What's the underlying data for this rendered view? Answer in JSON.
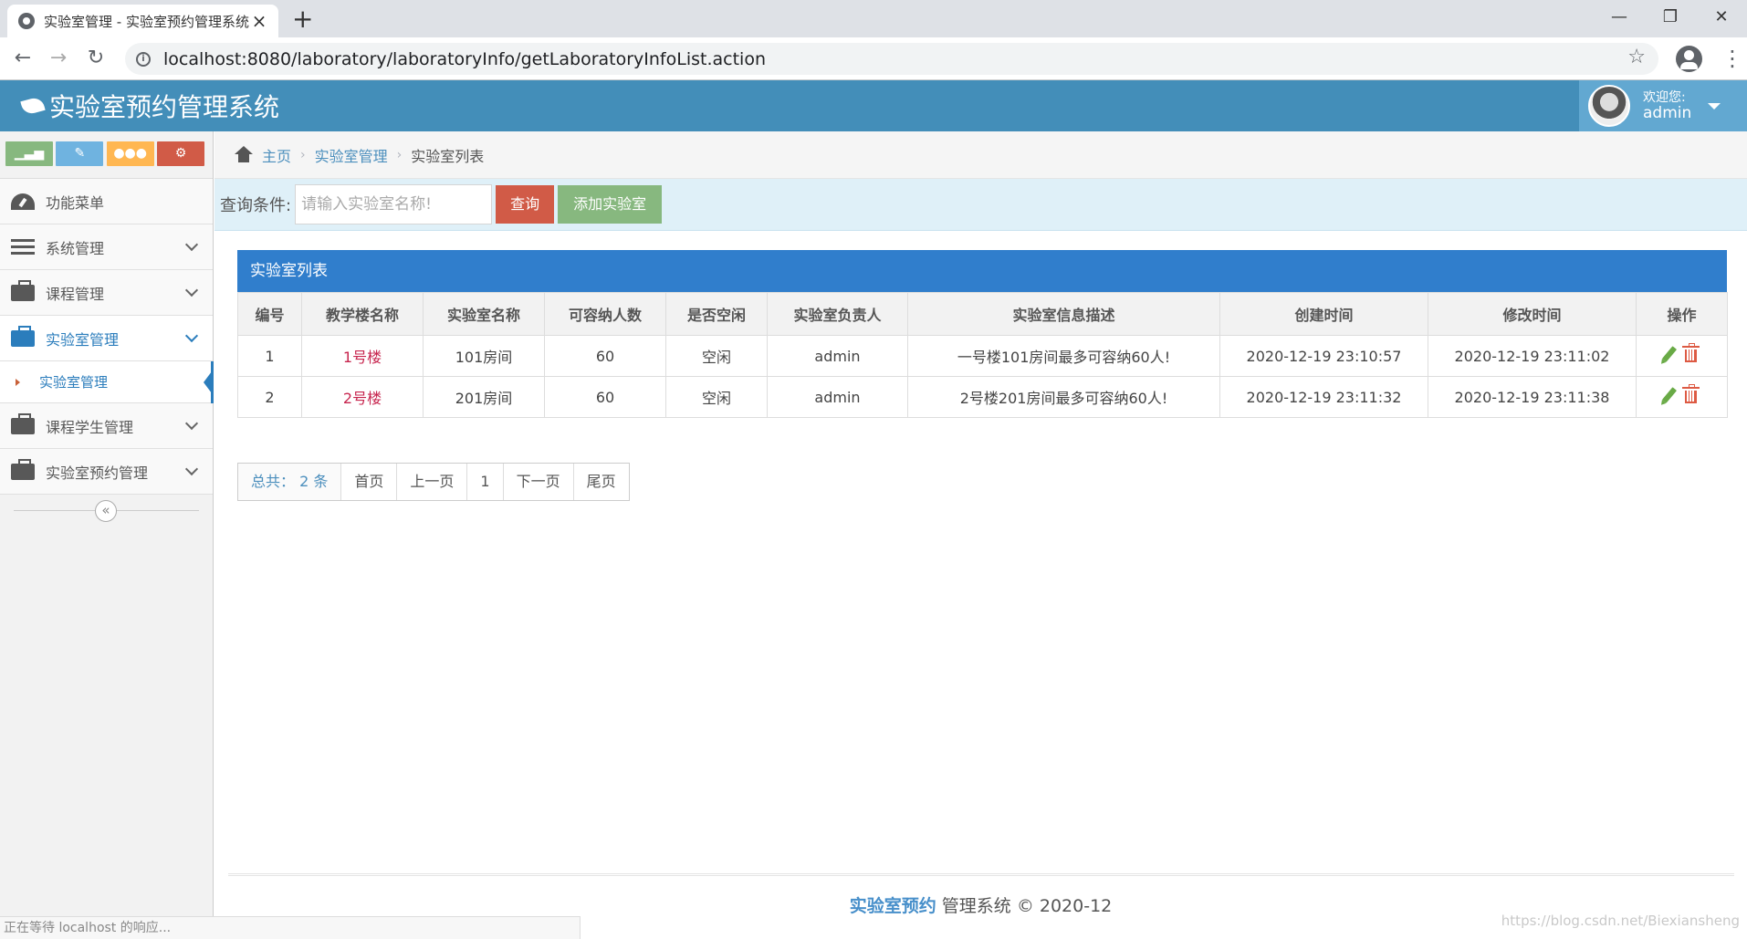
{
  "browser": {
    "tab_title": "实验室管理 - 实验室预约管理系统",
    "url": "localhost:8080/laboratory/laboratoryInfo/getLaboratoryInfoList.action"
  },
  "header": {
    "brand": "实验室预约管理系统",
    "welcome": "欢迎您:",
    "username": "admin",
    "color": "#438eb9"
  },
  "sidebar": {
    "shortcuts": [
      {
        "icon": "signal-icon",
        "color": "#87b87f"
      },
      {
        "icon": "pencil-icon",
        "color": "#6fb3e0"
      },
      {
        "icon": "users-icon",
        "color": "#ffb752"
      },
      {
        "icon": "cogs-icon",
        "color": "#d15b47"
      }
    ],
    "items": [
      {
        "label": "功能菜单",
        "icon": "dashboard-icon"
      },
      {
        "label": "系统管理",
        "icon": "list-icon"
      },
      {
        "label": "课程管理",
        "icon": "briefcase-icon"
      },
      {
        "label": "实验室管理",
        "icon": "briefcase-icon",
        "active": true
      },
      {
        "label": "课程学生管理",
        "icon": "briefcase-icon"
      },
      {
        "label": "实验室预约管理",
        "icon": "briefcase-icon"
      }
    ],
    "submenu": {
      "label": "实验室管理"
    }
  },
  "breadcrumb": {
    "home": "主页",
    "level1": "实验室管理",
    "current": "实验室列表"
  },
  "query": {
    "label": "查询条件:",
    "placeholder": "请输入实验室名称!",
    "search_button": "查询",
    "add_button": "添加实验室"
  },
  "table": {
    "title": "实验室列表",
    "columns": [
      "编号",
      "教学楼名称",
      "实验室名称",
      "可容纳人数",
      "是否空闲",
      "实验室负责人",
      "实验室信息描述",
      "创建时间",
      "修改时间",
      "操作"
    ],
    "rows": [
      [
        "1",
        "1号楼",
        "101房间",
        "60",
        "空闲",
        "admin",
        "一号楼101房间最多可容纳60人!",
        "2020-12-19 23:10:57",
        "2020-12-19 23:11:02"
      ],
      [
        "2",
        "2号楼",
        "201房间",
        "60",
        "空闲",
        "admin",
        "2号楼201房间最多可容纳60人!",
        "2020-12-19 23:11:32",
        "2020-12-19 23:11:38"
      ]
    ]
  },
  "pager": {
    "total": "总共：  2 条",
    "first": "首页",
    "prev": "上一页",
    "page": "1",
    "next": "下一页",
    "last": "尾页"
  },
  "footer": {
    "bold": "实验室预约",
    "rest": " 管理系统 © 2020-12"
  },
  "status": "正在等待 localhost 的响应...",
  "watermark": "https://blog.csdn.net/Biexiansheng"
}
